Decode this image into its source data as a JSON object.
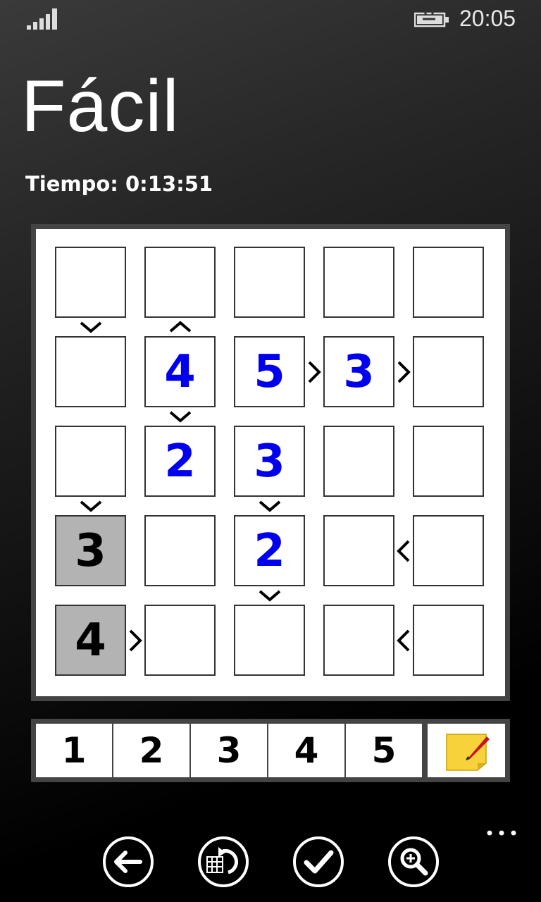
{
  "status": {
    "time": "20:05"
  },
  "page": {
    "title": "Fácil",
    "timer": "Tiempo: 0:13:51"
  },
  "board": {
    "size": 5,
    "cells": [
      [
        "",
        "",
        "",
        "",
        ""
      ],
      [
        "",
        "4",
        "5",
        "3",
        ""
      ],
      [
        "",
        "2",
        "3",
        "",
        ""
      ],
      [
        "3",
        "",
        "2",
        "",
        ""
      ],
      [
        "4",
        "",
        "",
        "",
        ""
      ]
    ],
    "given": [
      [
        false,
        false,
        false,
        false,
        false
      ],
      [
        false,
        false,
        false,
        false,
        false
      ],
      [
        false,
        false,
        false,
        false,
        false
      ],
      [
        true,
        false,
        false,
        false,
        false
      ],
      [
        true,
        false,
        false,
        false,
        false
      ]
    ],
    "inequalities": [
      {
        "between": [
          [
            0,
            0
          ],
          [
            1,
            0
          ]
        ],
        "symbol": "v"
      },
      {
        "between": [
          [
            0,
            1
          ],
          [
            1,
            1
          ]
        ],
        "symbol": "^"
      },
      {
        "between": [
          [
            1,
            2
          ],
          [
            1,
            3
          ]
        ],
        "symbol": ">"
      },
      {
        "between": [
          [
            1,
            3
          ],
          [
            1,
            4
          ]
        ],
        "symbol": ">"
      },
      {
        "between": [
          [
            1,
            1
          ],
          [
            2,
            1
          ]
        ],
        "symbol": "v"
      },
      {
        "between": [
          [
            2,
            0
          ],
          [
            3,
            0
          ]
        ],
        "symbol": "v"
      },
      {
        "between": [
          [
            2,
            2
          ],
          [
            3,
            2
          ]
        ],
        "symbol": "v"
      },
      {
        "between": [
          [
            3,
            3
          ],
          [
            3,
            4
          ]
        ],
        "symbol": "<"
      },
      {
        "between": [
          [
            3,
            2
          ],
          [
            4,
            2
          ]
        ],
        "symbol": "v"
      },
      {
        "between": [
          [
            4,
            0
          ],
          [
            4,
            1
          ]
        ],
        "symbol": ">"
      },
      {
        "between": [
          [
            4,
            3
          ],
          [
            4,
            4
          ]
        ],
        "symbol": "<"
      }
    ],
    "colors": {
      "user_digit": "#0000ee",
      "given_digit": "#000000",
      "given_bg": "#b3b3b3"
    }
  },
  "numpad": {
    "keys": [
      "1",
      "2",
      "3",
      "4",
      "5"
    ],
    "notes_icon": "sticky-note-pencil-icon"
  },
  "appbar": {
    "buttons": [
      {
        "name": "back-button",
        "icon": "arrow-left-icon"
      },
      {
        "name": "undo-button",
        "icon": "grid-undo-icon"
      },
      {
        "name": "check-button",
        "icon": "checkmark-icon"
      },
      {
        "name": "zoom-button",
        "icon": "zoom-in-icon"
      }
    ],
    "more_icon": "ellipsis-icon"
  }
}
